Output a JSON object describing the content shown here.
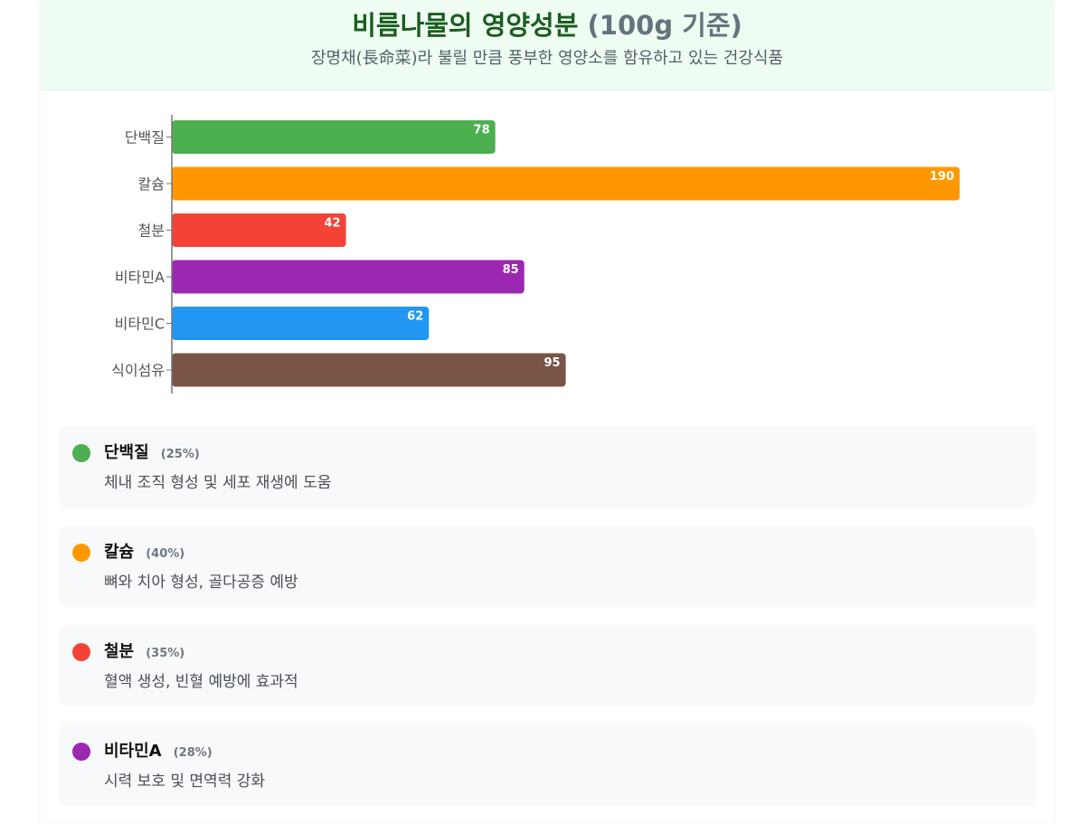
{
  "header": {
    "title_main": "비름나물의 영양성분",
    "title_unit": "(100g 기준)",
    "subtitle": "장명채(長命菜)라 불릴 만큼 풍부한 영양소를 함유하고 있는 건강식품"
  },
  "chart_data": {
    "type": "bar",
    "orientation": "horizontal",
    "categories": [
      "단백질",
      "칼슘",
      "철분",
      "비타민A",
      "비타민C",
      "식이섬유"
    ],
    "values": [
      78,
      190,
      42,
      85,
      62,
      95
    ],
    "colors": [
      "#4caf50",
      "#ff9800",
      "#f44336",
      "#9c27b0",
      "#2196f3",
      "#795548"
    ],
    "xlim": [
      0,
      200
    ],
    "grid": false,
    "legend": false,
    "data_labels": true
  },
  "nutrients": [
    {
      "name": "단백질",
      "percent": "(25%)",
      "desc": "체내 조직 형성 및 세포 재생에 도움",
      "color": "#4caf50"
    },
    {
      "name": "칼슘",
      "percent": "(40%)",
      "desc": "뼈와 치아 형성, 골다공증 예방",
      "color": "#ff9800"
    },
    {
      "name": "철분",
      "percent": "(35%)",
      "desc": "혈액 생성, 빈혈 예방에 효과적",
      "color": "#f44336"
    },
    {
      "name": "비타민A",
      "percent": "(28%)",
      "desc": "시력 보호 및 면역력 강화",
      "color": "#9c27b0"
    }
  ]
}
